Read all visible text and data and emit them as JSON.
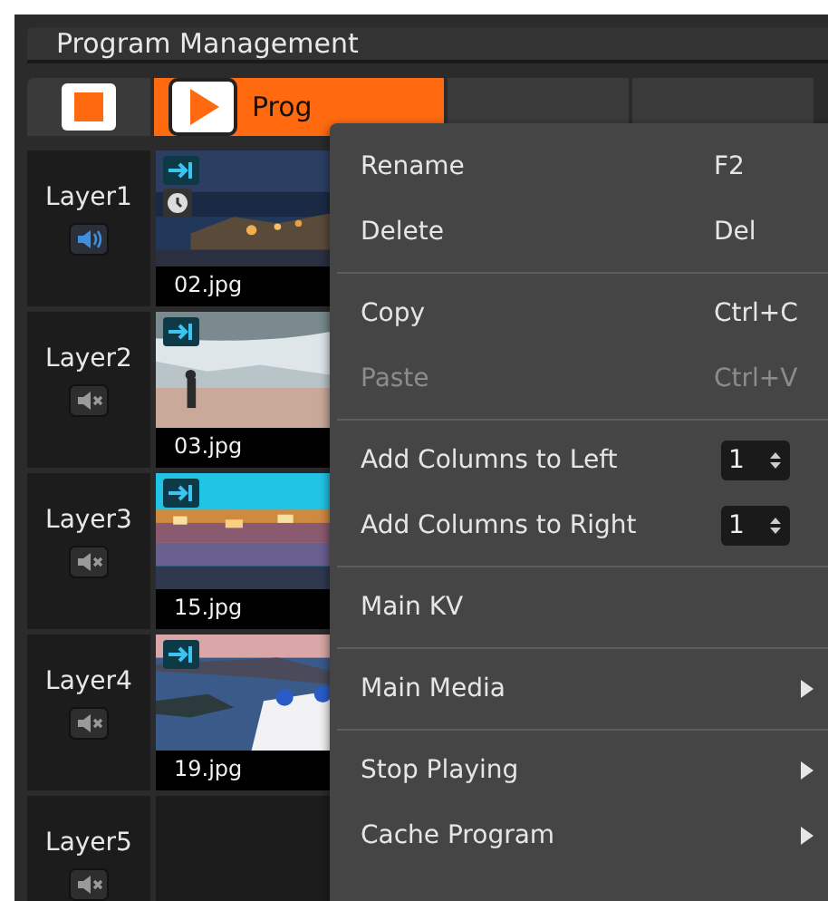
{
  "panel": {
    "title": "Program Management"
  },
  "toolbar": {
    "tabs": [
      {
        "label": "Prog",
        "selected": true
      },
      {
        "selected": false
      },
      {
        "selected": false
      }
    ]
  },
  "layers": [
    {
      "name": "Layer1",
      "muted": false,
      "media": {
        "file": "02.jpg",
        "scheduled": true
      }
    },
    {
      "name": "Layer2",
      "muted": true,
      "media": {
        "file": "03.jpg",
        "scheduled": false
      }
    },
    {
      "name": "Layer3",
      "muted": true,
      "media": {
        "file": "15.jpg",
        "scheduled": false
      }
    },
    {
      "name": "Layer4",
      "muted": true,
      "media": {
        "file": "19.jpg",
        "scheduled": false
      }
    },
    {
      "name": "Layer5",
      "muted": true
    }
  ],
  "context_menu": [
    {
      "kind": "item",
      "label": "Rename",
      "shortcut": "F2",
      "disabled": false,
      "submenu": false
    },
    {
      "kind": "item",
      "label": "Delete",
      "shortcut": "Del",
      "disabled": false,
      "submenu": false
    },
    {
      "kind": "separator"
    },
    {
      "kind": "item",
      "label": "Copy",
      "shortcut": "Ctrl+C",
      "disabled": false,
      "submenu": false
    },
    {
      "kind": "item",
      "label": "Paste",
      "shortcut": "Ctrl+V",
      "disabled": true,
      "submenu": false
    },
    {
      "kind": "separator"
    },
    {
      "kind": "spin",
      "label": "Add Columns to Left",
      "value": "1"
    },
    {
      "kind": "spin",
      "label": "Add Columns to Right",
      "value": "1"
    },
    {
      "kind": "separator"
    },
    {
      "kind": "item",
      "label": "Main KV",
      "disabled": false,
      "submenu": false
    },
    {
      "kind": "separator"
    },
    {
      "kind": "item",
      "label": "Main Media",
      "disabled": false,
      "submenu": true
    },
    {
      "kind": "separator"
    },
    {
      "kind": "item",
      "label": "Stop Playing",
      "disabled": false,
      "submenu": true
    },
    {
      "kind": "item",
      "label": "Cache Program",
      "disabled": false,
      "submenu": true
    }
  ]
}
